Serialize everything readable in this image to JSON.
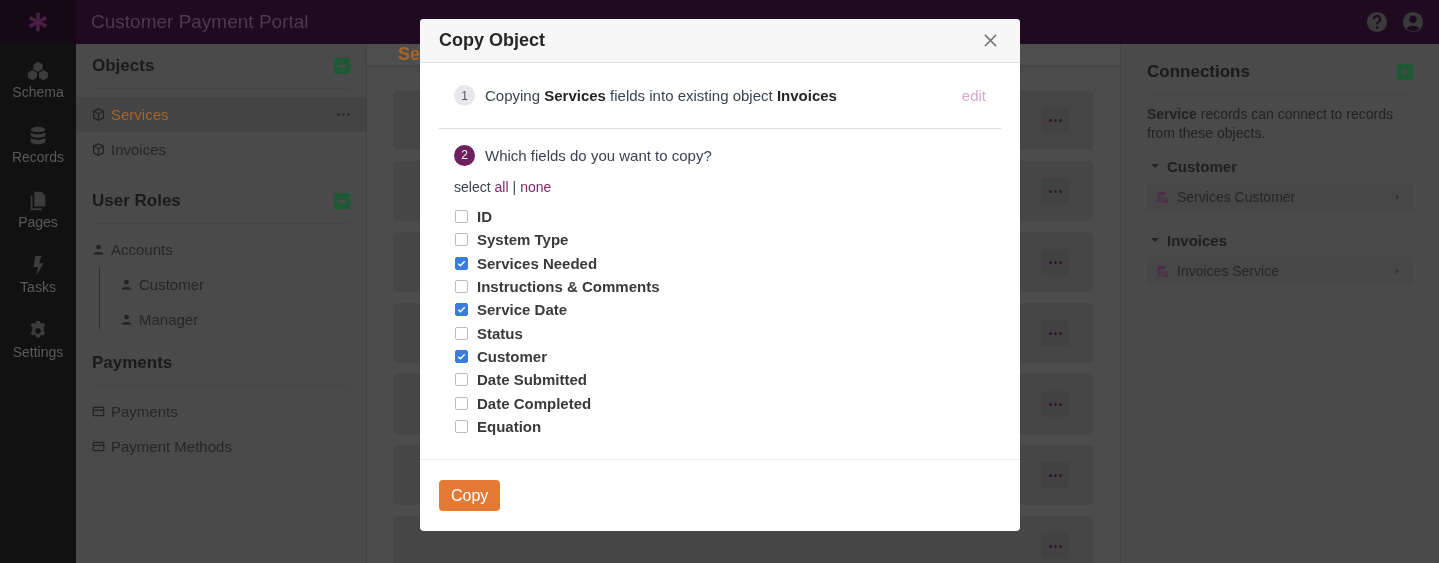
{
  "header": {
    "title": "Customer Payment Portal"
  },
  "nav": [
    {
      "label": "Schema"
    },
    {
      "label": "Records"
    },
    {
      "label": "Pages"
    },
    {
      "label": "Tasks"
    },
    {
      "label": "Settings"
    }
  ],
  "sidebar": [
    {
      "title": "Objects",
      "add": true,
      "items": [
        {
          "label": "Services",
          "selected": true,
          "kind": "object"
        },
        {
          "label": "Invoices",
          "selected": false,
          "kind": "object"
        }
      ]
    },
    {
      "title": "User Roles",
      "add": true,
      "items": [
        {
          "label": "Accounts",
          "selected": false,
          "kind": "role",
          "children": [
            {
              "label": "Customer",
              "selected": false,
              "kind": "role"
            },
            {
              "label": "Manager",
              "selected": false,
              "kind": "role"
            }
          ]
        }
      ]
    },
    {
      "title": "Payments",
      "add": false,
      "items": [
        {
          "label": "Payments",
          "selected": false,
          "kind": "card"
        },
        {
          "label": "Payment Methods",
          "selected": false,
          "kind": "card"
        }
      ]
    }
  ],
  "main": {
    "tab_title": "Se"
  },
  "connections": {
    "title": "Connections",
    "description": "**Service** records can connect to records from these objects.",
    "groups": [
      {
        "name": "Customer",
        "expanded": true,
        "items": [
          "Services Customer"
        ]
      },
      {
        "name": "Invoices",
        "expanded": true,
        "items": [
          "Invoices Service"
        ]
      }
    ]
  },
  "modal": {
    "title": "Copy Object",
    "step1": {
      "number": "1",
      "text": "Copying **Services** fields into existing object **Invoices**",
      "action": "edit"
    },
    "step2": {
      "number": "2",
      "text": "Which fields do you want to copy?",
      "select_label": "select",
      "all": "all",
      "separator": "|",
      "none": "none"
    },
    "fields": [
      {
        "label": "ID",
        "checked": false
      },
      {
        "label": "System Type",
        "checked": false
      },
      {
        "label": "Services Needed",
        "checked": true
      },
      {
        "label": "Instructions & Comments",
        "checked": false
      },
      {
        "label": "Service Date",
        "checked": true
      },
      {
        "label": "Status",
        "checked": false
      },
      {
        "label": "Customer",
        "checked": true
      },
      {
        "label": "Date Submitted",
        "checked": false
      },
      {
        "label": "Date Completed",
        "checked": false
      },
      {
        "label": "Equation",
        "checked": false
      }
    ],
    "button": "Copy"
  }
}
